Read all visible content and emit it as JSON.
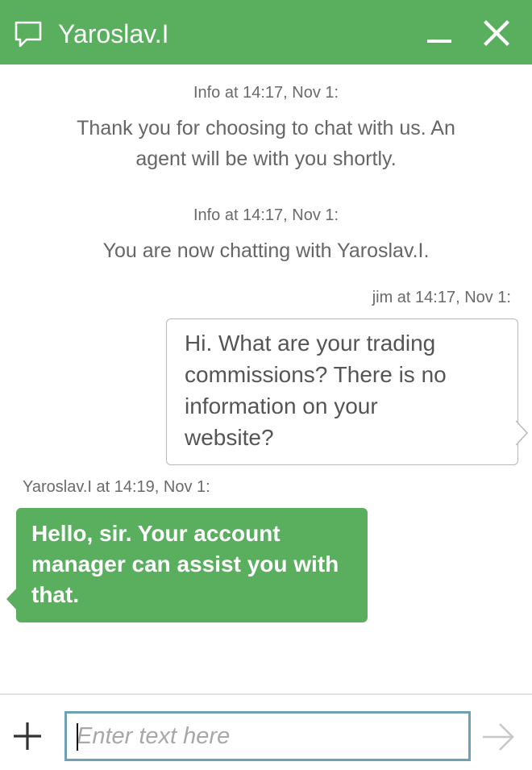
{
  "header": {
    "title": "Yaroslav.I",
    "background_color": "#5aaf5f",
    "icons": [
      "chat-bubble-icon",
      "minimize-icon",
      "close-icon"
    ]
  },
  "messages": {
    "info1": {
      "meta": "Info at 14:17, Nov 1:",
      "text_line1": "Thank you for choosing to chat with us. An",
      "text_line2": "agent will be with you shortly."
    },
    "info2": {
      "meta": "Info at 14:17, Nov 1:",
      "text": "You are now chatting with Yaroslav.I."
    },
    "user": {
      "meta": "jim at 14:17, Nov 1:",
      "line1": "Hi. What are your trading",
      "line2": "commissions? There is no",
      "line3": "information on your",
      "line4": "website?"
    },
    "agent": {
      "meta": "Yaroslav.I at 14:19, Nov 1:",
      "line1": "Hello, sir. Your account",
      "line2": "manager can assist you with",
      "line3": "that.",
      "bubble_color": "#5aaf5f"
    }
  },
  "composer": {
    "placeholder": "Enter text here",
    "value": "",
    "input_border_color": "#6fa0b3",
    "icons": [
      "plus-icon",
      "send-arrow-icon"
    ]
  }
}
